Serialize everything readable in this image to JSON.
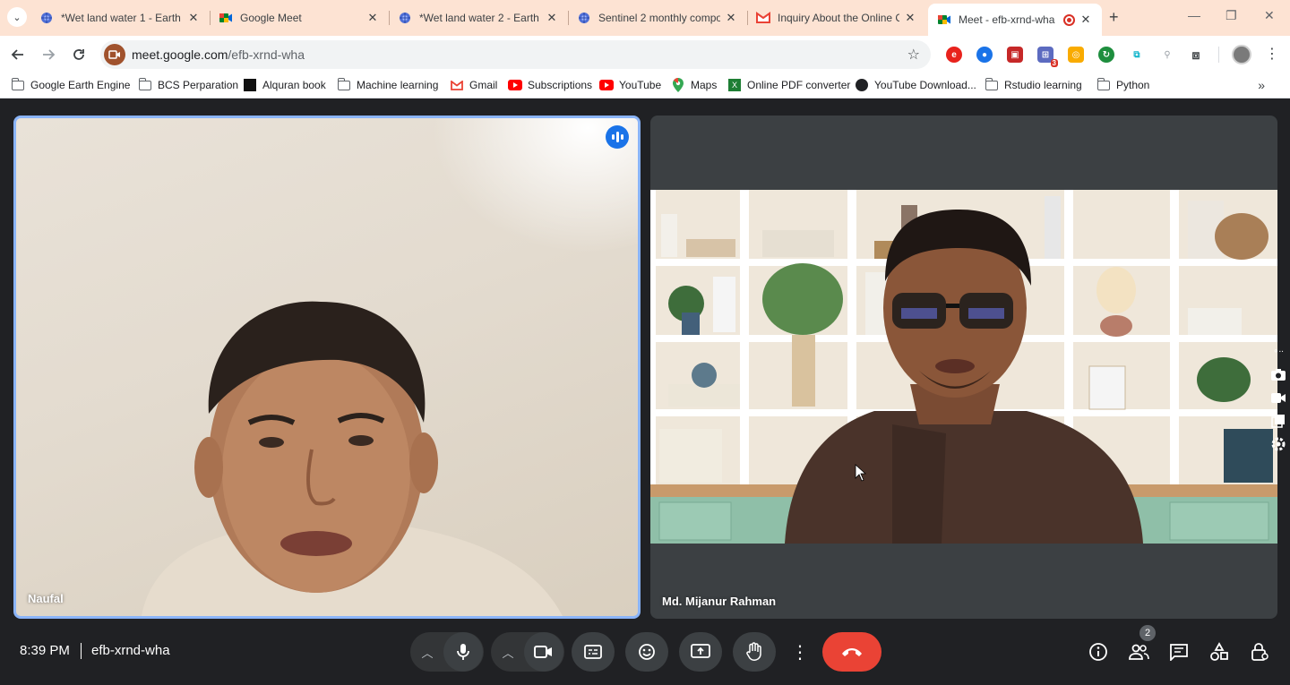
{
  "tabs": [
    {
      "title": "*Wet land water 1 - Earth E",
      "icon": "earth-engine-icon"
    },
    {
      "title": "Google Meet",
      "icon": "meet-icon"
    },
    {
      "title": "*Wet land water 2 - Earth E",
      "icon": "earth-engine-icon"
    },
    {
      "title": "Sentinel 2 monthly compo",
      "icon": "earth-engine-icon"
    },
    {
      "title": "Inquiry About the Online C",
      "icon": "gmail-icon"
    },
    {
      "title": "Meet - efb-xrnd-wha",
      "icon": "meet-icon",
      "active": true
    }
  ],
  "toolbar": {
    "url_host": "meet.google.com",
    "url_path": "/efb-xrnd-wha"
  },
  "bookmarks": [
    {
      "label": "Google Earth Engine",
      "icon": "folder-icon"
    },
    {
      "label": "BCS Perparation",
      "icon": "folder-icon"
    },
    {
      "label": "Alquran book",
      "icon": "alquran-icon"
    },
    {
      "label": "Machine learning",
      "icon": "folder-icon"
    },
    {
      "label": "Gmail",
      "icon": "gmail-icon"
    },
    {
      "label": "Subscriptions",
      "icon": "youtube-icon"
    },
    {
      "label": "YouTube",
      "icon": "youtube-icon"
    },
    {
      "label": "Maps",
      "icon": "maps-icon"
    },
    {
      "label": "Online PDF converter",
      "icon": "pdf-icon"
    },
    {
      "label": "YouTube Download...",
      "icon": "web-icon"
    },
    {
      "label": "Rstudio learning",
      "icon": "folder-icon"
    },
    {
      "label": "Python",
      "icon": "folder-icon"
    }
  ],
  "participants": [
    {
      "name": "Naufal",
      "speaking": true
    },
    {
      "name": "Md. Mijanur Rahman",
      "speaking": false
    }
  ],
  "meeting": {
    "time": "8:39 PM",
    "code": "efb-xrnd-wha",
    "participant_count": "2"
  },
  "extensions": {
    "badge_count": "3"
  },
  "colors": {
    "tabstrip": "#fde3d3",
    "accent_blue": "#8ab4f8",
    "hangup_red": "#ea4335",
    "meet_bg": "#202124"
  }
}
